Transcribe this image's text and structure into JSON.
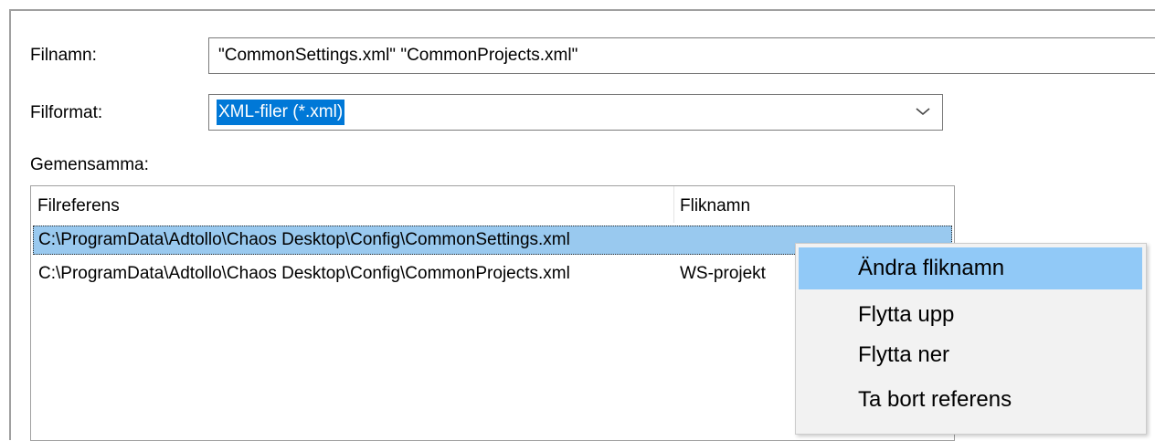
{
  "form": {
    "filename_label": "Filnamn:",
    "filename_value": "\"CommonSettings.xml\" \"CommonProjects.xml\"",
    "format_label": "Filformat:",
    "format_value": "XML-filer (*.xml)",
    "common_label": "Gemensamma:"
  },
  "list": {
    "columns": [
      "Filreferens",
      "Fliknamn"
    ],
    "rows": [
      {
        "path": "C:\\ProgramData\\Adtollo\\Chaos Desktop\\Config\\CommonSettings.xml",
        "tab": "",
        "selected": true
      },
      {
        "path": "C:\\ProgramData\\Adtollo\\Chaos Desktop\\Config\\CommonProjects.xml",
        "tab": "WS-projekt",
        "selected": false
      }
    ]
  },
  "context_menu": {
    "items": [
      "Ändra fliknamn",
      "Flytta upp",
      "Flytta ner",
      "Ta bort referens"
    ],
    "highlighted_index": 0
  },
  "icons": {
    "dropdown": "chevron-down-icon"
  },
  "colors": {
    "selection": "#0078d7",
    "row_selected": "#99c9ef",
    "menu_highlight": "#91c9f7",
    "menu_bg": "#f2f2f2"
  }
}
